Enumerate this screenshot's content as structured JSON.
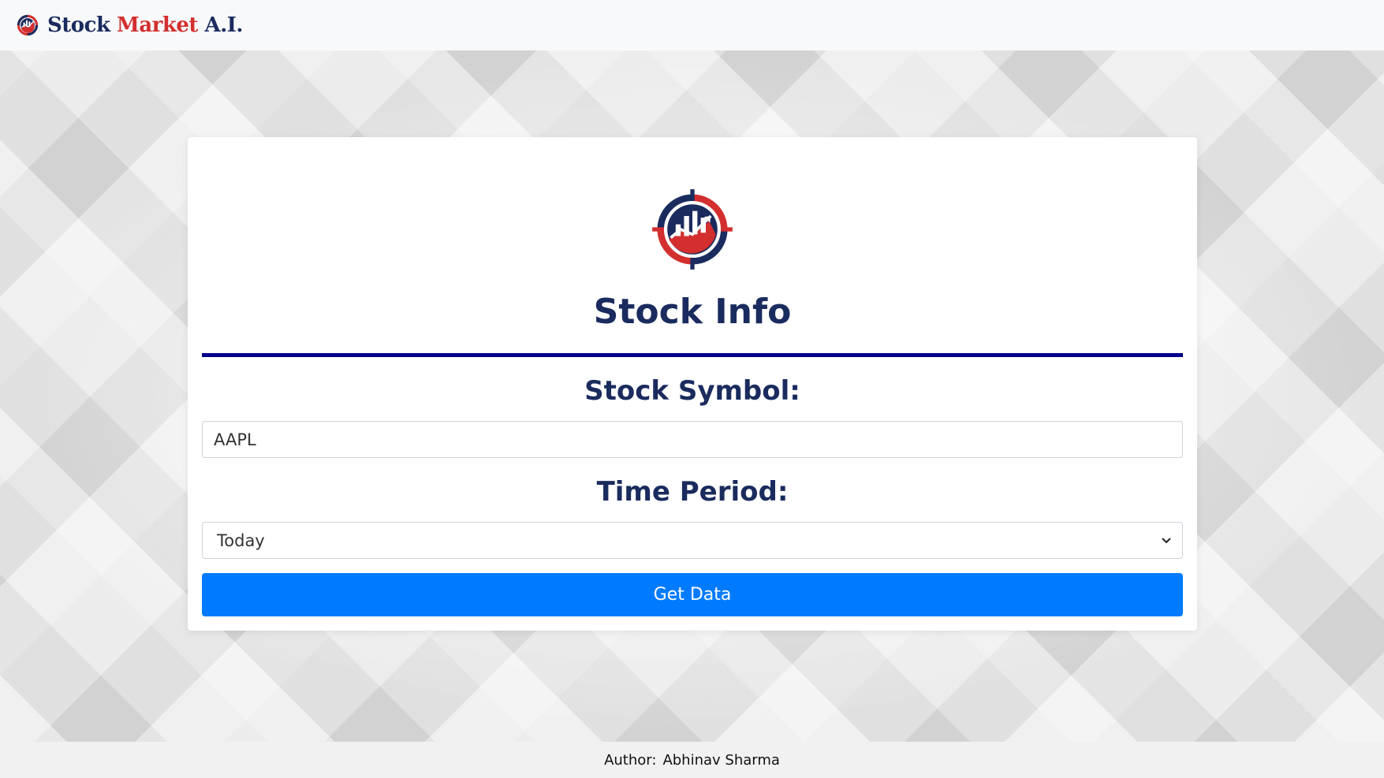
{
  "navbar": {
    "brand_word1": "Stock",
    "brand_word2": "Market",
    "brand_word3": "A.I.",
    "brand_icon": "stock-chart-target-logo"
  },
  "card": {
    "logo_icon": "stock-chart-target-logo",
    "title": "Stock Info",
    "symbol_label": "Stock Symbol:",
    "symbol_value": "AAPL",
    "period_label": "Time Period:",
    "period_selected": "Today",
    "submit_label": "Get Data"
  },
  "footer": {
    "author_label": "Author:",
    "author_name": "Abhinav Sharma"
  },
  "colors": {
    "navy": "#1a2b5e",
    "red": "#d32f2f",
    "primary": "#007bff",
    "rule": "#00008b"
  }
}
